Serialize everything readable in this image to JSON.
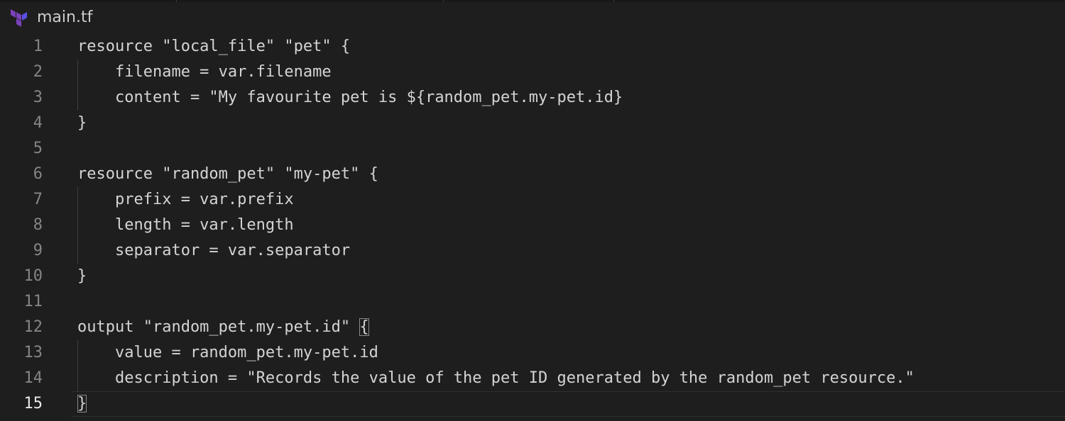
{
  "file": {
    "name": "main.tf",
    "icon": "terraform-icon",
    "icon_color": "#7b42bc"
  },
  "editor": {
    "active_line": 15,
    "line_numbers": [
      "1",
      "2",
      "3",
      "4",
      "5",
      "6",
      "7",
      "8",
      "9",
      "10",
      "11",
      "12",
      "13",
      "14",
      "15"
    ],
    "lines": [
      "resource \"local_file\" \"pet\" {",
      "    filename = var.filename",
      "    content = \"My favourite pet is ${random_pet.my-pet.id}",
      "}",
      "",
      "resource \"random_pet\" \"my-pet\" {",
      "    prefix = var.prefix",
      "    length = var.length",
      "    separator = var.separator",
      "}",
      "",
      "output \"random_pet.my-pet.id\" ",
      "    value = random_pet.my-pet.id",
      "    description = \"Records the value of the pet ID generated by the random_pet resource.\"",
      ""
    ],
    "open_brace": "{",
    "close_brace": "}"
  },
  "colors": {
    "background": "#1e1e1e",
    "text": "#d4d4d4",
    "line_number": "#858585",
    "active_line_number": "#e8e8e8"
  }
}
